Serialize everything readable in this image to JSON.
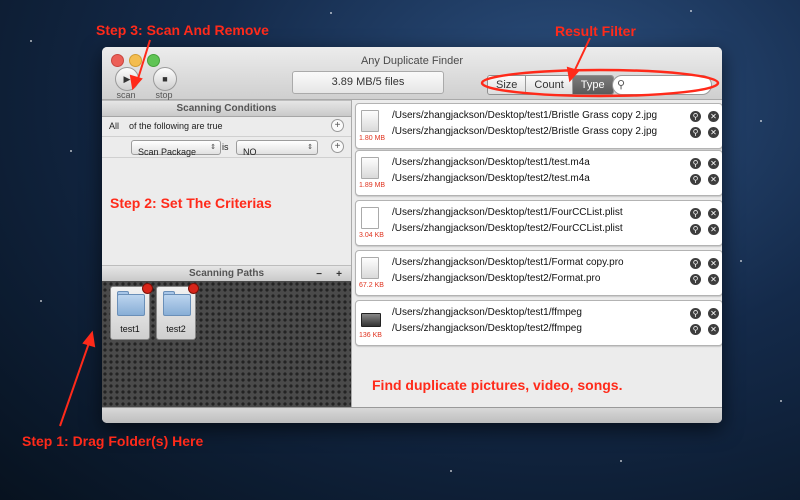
{
  "annotations": {
    "step3": "Step 3: Scan And Remove",
    "result_filter": "Result Filter",
    "step2": "Step 2: Set The Criterias",
    "tagline": "Find duplicate pictures, video, songs.",
    "step1": "Step 1: Drag Folder(s) Here"
  },
  "colors": {
    "annotation": "#ff2a1a",
    "size_text": "#e0331f",
    "active_segment": "#6a6a6a"
  },
  "window": {
    "title": "Any Duplicate Finder"
  },
  "toolbar": {
    "scan_label": "scan",
    "stop_label": "stop",
    "scan_icon": "play-icon",
    "stop_icon": "stop-icon",
    "stats": "3.89 MB/5 files",
    "filters": [
      "Size",
      "Count",
      "Type"
    ],
    "active_filter": "Type",
    "search_placeholder": ""
  },
  "conditions": {
    "header": "Scanning Conditions",
    "match_all": "All",
    "match_text": "of the following are true",
    "rule": {
      "field": "Scan Package",
      "operator": "is",
      "value": "NO"
    }
  },
  "paths": {
    "header": "Scanning Paths",
    "remove_label": "−",
    "add_label": "+",
    "folders": [
      "test1",
      "test2"
    ]
  },
  "results": [
    {
      "size": "1.80 MB",
      "icon": "image-file-icon",
      "files": [
        "/Users/zhangjackson/Desktop/test1/Bristle Grass copy 2.jpg",
        "/Users/zhangjackson/Desktop/test2/Bristle Grass copy 2.jpg"
      ]
    },
    {
      "size": "1.89 MB",
      "icon": "audio-file-icon",
      "files": [
        "/Users/zhangjackson/Desktop/test1/test.m4a",
        "/Users/zhangjackson/Desktop/test2/test.m4a"
      ]
    },
    {
      "size": "3.04 KB",
      "icon": "plist-file-icon",
      "files": [
        "/Users/zhangjackson/Desktop/test1/FourCCList.plist",
        "/Users/zhangjackson/Desktop/test2/FourCCList.plist"
      ]
    },
    {
      "size": "67.2 KB",
      "icon": "project-file-icon",
      "files": [
        "/Users/zhangjackson/Desktop/test1/Format copy.pro",
        "/Users/zhangjackson/Desktop/test2/Format.pro"
      ]
    },
    {
      "size": "136 KB",
      "icon": "executable-file-icon",
      "files": [
        "/Users/zhangjackson/Desktop/test1/ffmpeg",
        "/Users/zhangjackson/Desktop/test2/ffmpeg"
      ]
    }
  ]
}
